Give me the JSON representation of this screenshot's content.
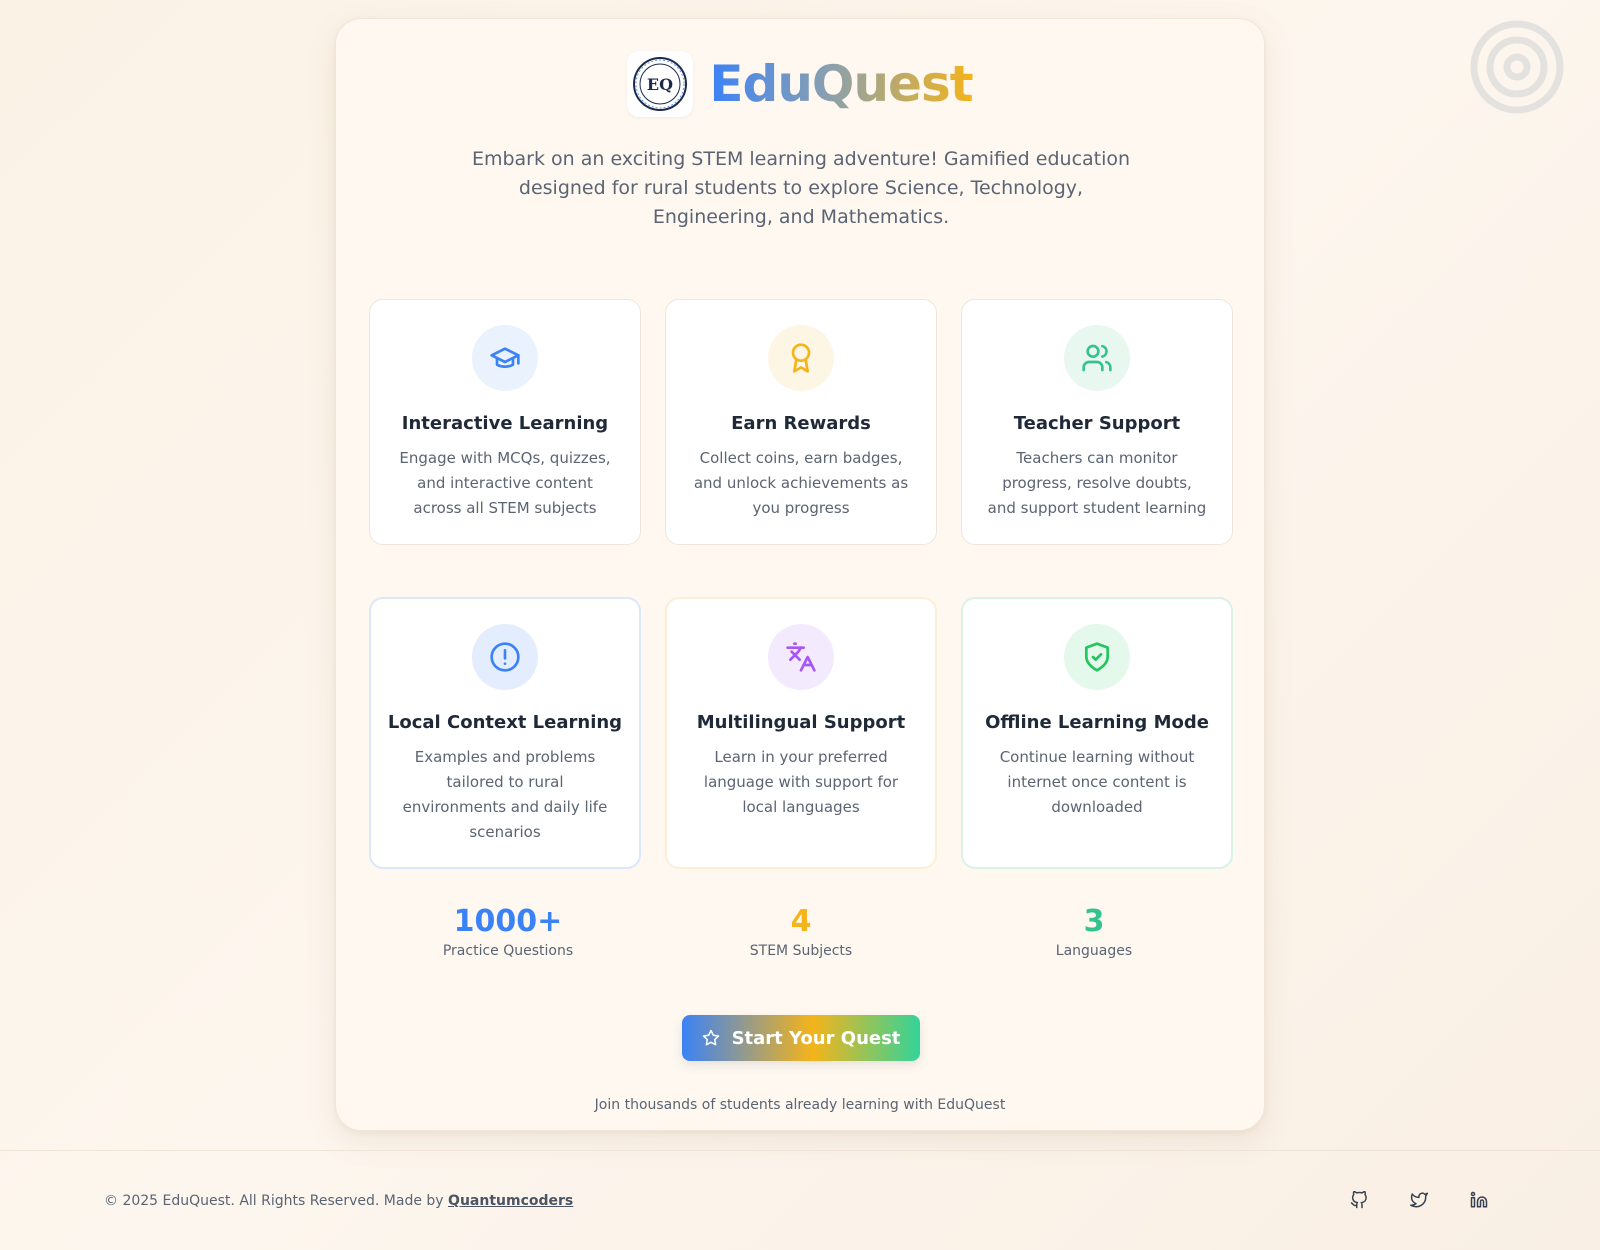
{
  "brand": {
    "name": "EduQuest",
    "logo_text": "EQ"
  },
  "tagline": "Embark on an exciting STEM learning adventure! Gamified education designed for rural students to explore Science, Technology, Engineering, and Mathematics.",
  "features": [
    {
      "title": "Interactive Learning",
      "desc": "Engage with MCQs, quizzes, and interactive content across all STEM subjects",
      "icon": "graduation-cap-icon",
      "color": "#3b82f6",
      "bg": "#eaf2fe"
    },
    {
      "title": "Earn Rewards",
      "desc": "Collect coins, earn badges, and unlock achievements as you progress",
      "icon": "award-icon",
      "color": "#f4b41a",
      "bg": "#fef6e4"
    },
    {
      "title": "Teacher Support",
      "desc": "Teachers can monitor progress, resolve doubts, and support student learning",
      "icon": "users-icon",
      "color": "#34c38f",
      "bg": "#e8f8f1"
    },
    {
      "title": "Local Context Learning",
      "desc": "Examples and problems tailored to rural environments and daily life scenarios",
      "icon": "alert-circle-icon",
      "color": "#3b82f6",
      "bg": "#e3edfd"
    },
    {
      "title": "Multilingual Support",
      "desc": "Learn in your preferred language with support for local languages",
      "icon": "languages-icon",
      "color": "#a855f7",
      "bg": "#f3eafd"
    },
    {
      "title": "Offline Learning Mode",
      "desc": "Continue learning without internet once content is downloaded",
      "icon": "shield-check-icon",
      "color": "#22c55e",
      "bg": "#e4f8ec"
    }
  ],
  "stats": [
    {
      "value": "1000+",
      "label": "Practice Questions",
      "color": "#3b82f6"
    },
    {
      "value": "4",
      "label": "STEM Subjects",
      "color": "#f4b41a"
    },
    {
      "value": "3",
      "label": "Languages",
      "color": "#34c38f"
    }
  ],
  "cta": {
    "label": "Start Your Quest",
    "subtext": "Join thousands of students already learning with EduQuest"
  },
  "footer": {
    "copyright": "© 2025 EduQuest. All Rights Reserved. Made by",
    "author": "Quantumcoders",
    "social": [
      "github-icon",
      "twitter-icon",
      "linkedin-icon"
    ]
  }
}
